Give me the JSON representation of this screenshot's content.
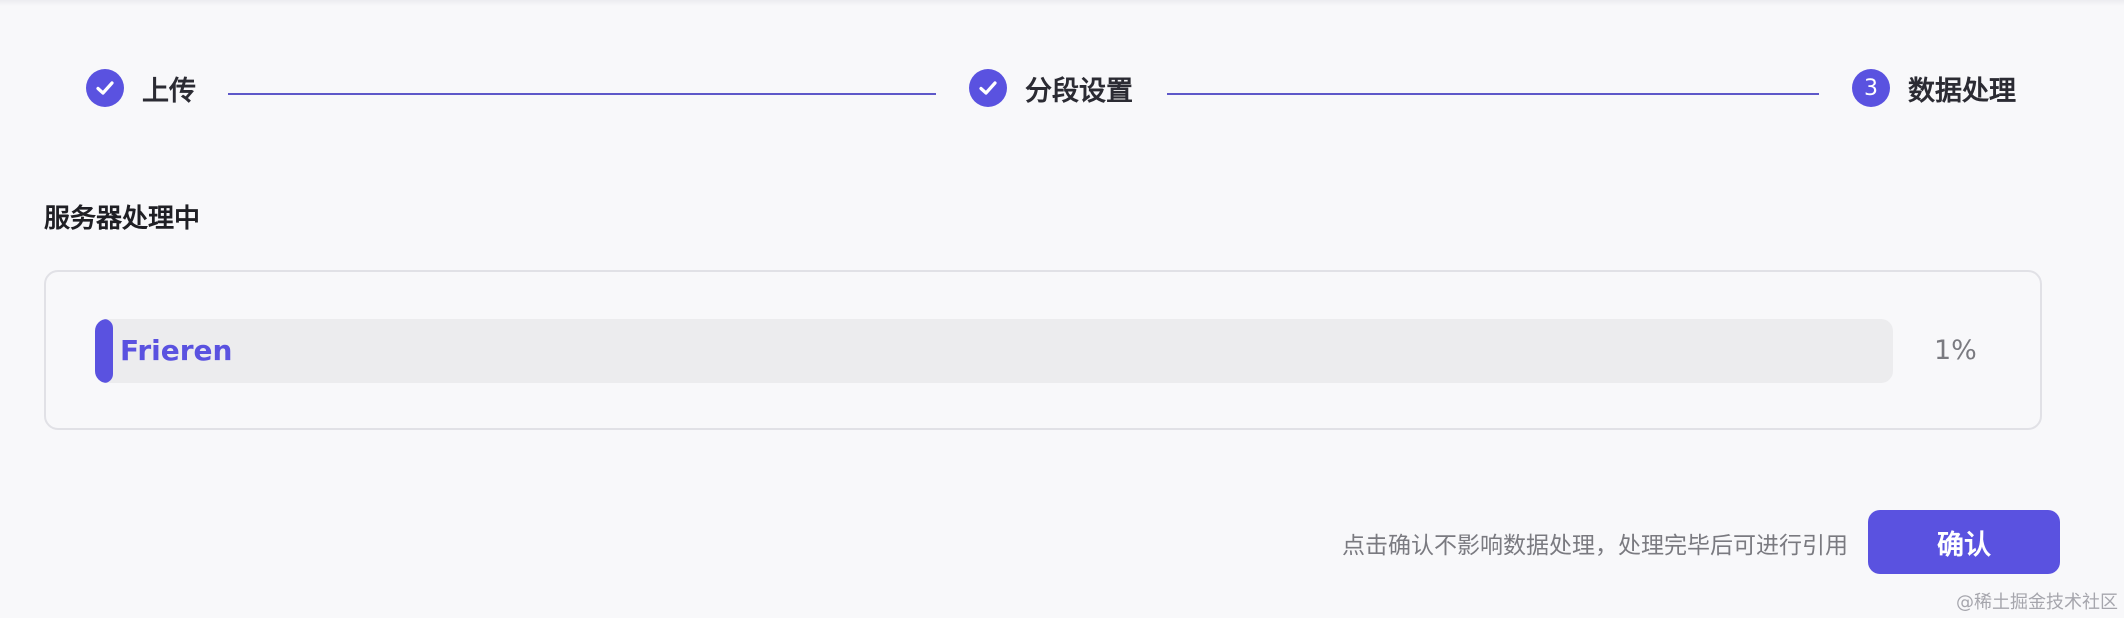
{
  "steps": [
    {
      "label": "上传",
      "status": "done",
      "icon": "check-icon"
    },
    {
      "label": "分段设置",
      "status": "done",
      "icon": "check-icon"
    },
    {
      "label": "数据处理",
      "status": "active",
      "number": "3"
    }
  ],
  "section_title": "服务器处理中",
  "progress": {
    "name": "Frieren",
    "percent_text": "1%",
    "percent": 0.01
  },
  "footer": {
    "hint": "点击确认不影响数据处理，处理完毕后可进行引用",
    "confirm_label": "确认"
  },
  "watermark": "@稀土掘金技术社区",
  "colors": {
    "accent": "#5a52e0",
    "track": "#ececee",
    "background": "#f8f8fa"
  }
}
